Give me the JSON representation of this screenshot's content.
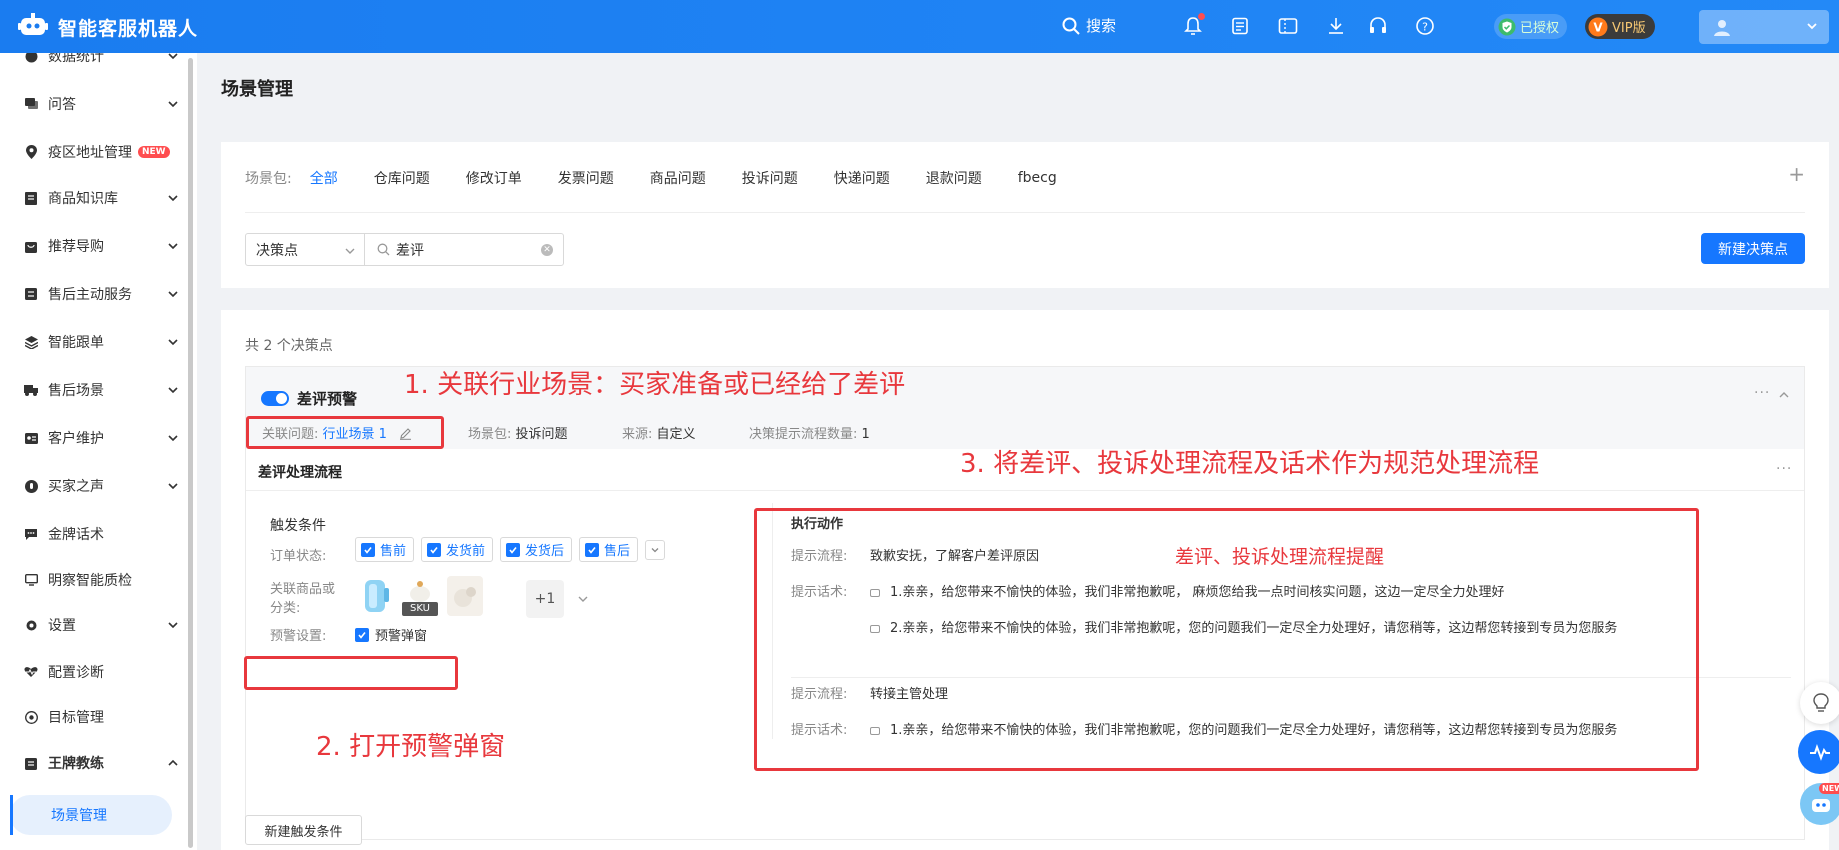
{
  "app": {
    "title": "智能客服机器人",
    "search_label": "搜索",
    "auth_badge": "已授权",
    "vip_badge": "VIP版"
  },
  "sidebar": {
    "items": [
      {
        "label": "数据统计"
      },
      {
        "label": "问答"
      },
      {
        "label": "疫区地址管理",
        "tag": "NEW"
      },
      {
        "label": "商品知识库"
      },
      {
        "label": "推荐导购"
      },
      {
        "label": "售后主动服务"
      },
      {
        "label": "智能跟单"
      },
      {
        "label": "售后场景"
      },
      {
        "label": "客户维护"
      },
      {
        "label": "买家之声"
      },
      {
        "label": "金牌话术"
      },
      {
        "label": "明察智能质检"
      },
      {
        "label": "设置"
      },
      {
        "label": "配置诊断"
      },
      {
        "label": "目标管理"
      },
      {
        "label": "王牌教练"
      }
    ],
    "active_item": "场景管理"
  },
  "page": {
    "title": "场景管理"
  },
  "filter": {
    "prefix": "场景包:",
    "tabs": [
      "全部",
      "仓库问题",
      "修改订单",
      "发票问题",
      "商品问题",
      "投诉问题",
      "快递问题",
      "退款问题",
      "fbecg"
    ],
    "active_tab": "全部",
    "select_value": "决策点",
    "search_value": "差评",
    "new_button": "新建决策点"
  },
  "list": {
    "count_text": "共 2 个决策点",
    "decision_point": {
      "name": "差评预警",
      "enabled": true,
      "related_label": "关联问题:",
      "related_value": "行业场景 1",
      "package_label": "场景包:",
      "package_value": "投诉问题",
      "source_label": "来源:",
      "source_value": "自定义",
      "flow_count_label": "决策提示流程数量:",
      "flow_count_value": "1"
    },
    "flow": {
      "title": "差评处理流程",
      "trigger_title": "触发条件",
      "order_status_label": "订单状态:",
      "order_statuses": [
        "售前",
        "发货前",
        "发货后",
        "售后"
      ],
      "product_label_1": "关联商品或",
      "product_label_2": "分类:",
      "sku_tag": "SKU",
      "more_count": "+1",
      "warning_label": "预警设置:",
      "warning_option": "预警弹窗",
      "action_title": "执行动作",
      "steps": [
        {
          "flow_label": "提示流程:",
          "flow_value": "致歉安抚，了解客户差评原因",
          "script_label": "提示话术:",
          "scripts": [
            "1.亲亲，给您带来不愉快的体验，我们非常抱歉呢， 麻烦您给我一点时间核实问题，这边一定尽全力处理好",
            "2.亲亲，给您带来不愉快的体验，我们非常抱歉呢，您的问题我们一定尽全力处理好，请您稍等，这边帮您转接到专员为您服务"
          ]
        },
        {
          "flow_label": "提示流程:",
          "flow_value": "转接主管处理",
          "script_label": "提示话术:",
          "scripts": [
            "1.亲亲，给您带来不愉快的体验，我们非常抱歉呢，您的问题我们一定尽全力处理好，请您稍等，这边帮您转接到专员为您服务"
          ]
        }
      ],
      "add_trigger_button": "新建触发条件"
    }
  },
  "annotations": {
    "a1": "1. 关联行业场景：买家准备或已经给了差评",
    "a2": "2. 打开预警弹窗",
    "a3": "3. 将差评、投诉处理流程及话术作为规范处理流程",
    "a4": "差评、投诉处理流程提醒"
  },
  "colors": {
    "primary": "#1677ff",
    "annotation_red": "#e8383d",
    "topbar": "#1a7cf0"
  }
}
